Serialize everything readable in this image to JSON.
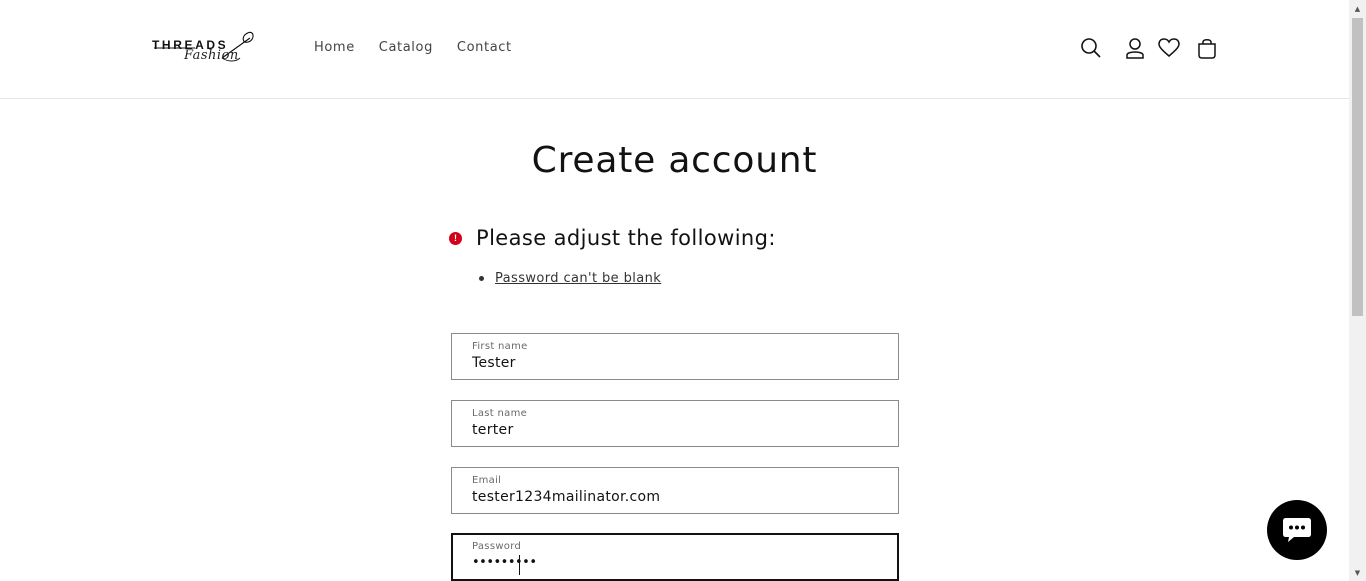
{
  "header": {
    "logo": {
      "text": "THREADS",
      "script": "Fashion"
    },
    "nav": [
      {
        "label": "Home"
      },
      {
        "label": "Catalog"
      },
      {
        "label": "Contact"
      }
    ],
    "icons": [
      "search-icon",
      "account-icon",
      "wishlist-heart-icon",
      "cart-icon"
    ]
  },
  "page": {
    "title": "Create account",
    "error": {
      "heading": "Please adjust the following:",
      "icon_symbol": "!",
      "items": [
        {
          "label": "Password can't be blank"
        }
      ]
    },
    "form": {
      "first_name": {
        "label": "First name",
        "value": "Tester"
      },
      "last_name": {
        "label": "Last name",
        "value": "terter"
      },
      "email": {
        "label": "Email",
        "value": "tester1234mailinator.com"
      },
      "password": {
        "label": "Password",
        "value": "•••••••••"
      }
    }
  },
  "colors": {
    "error": "#d2001c",
    "text": "#121212",
    "border": "#8a8a8a",
    "chat_button": "#000000"
  },
  "chat": {
    "icon": "chat-bubble-icon"
  }
}
